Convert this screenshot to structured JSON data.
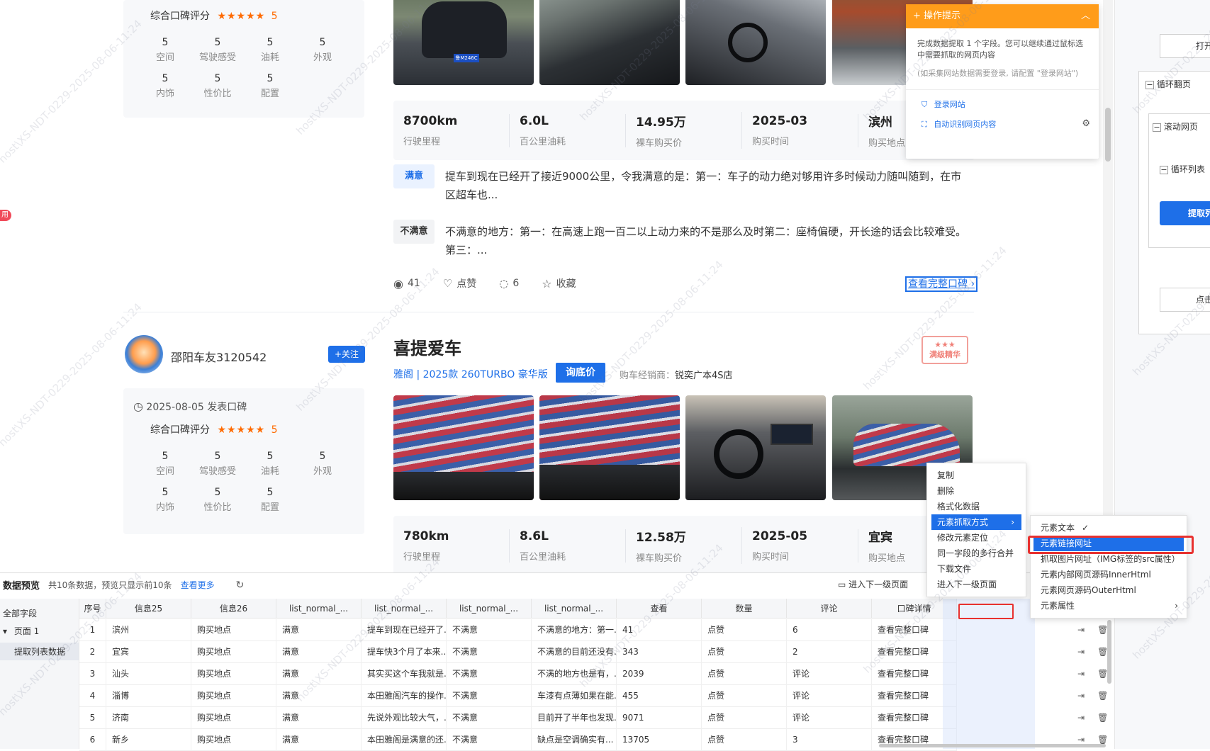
{
  "review1": {
    "rating_label": "综合口碑评分",
    "stars": "★★★★★",
    "rating": "5",
    "scores": [
      {
        "value": "5",
        "label": "空间"
      },
      {
        "value": "5",
        "label": "驾驶感受"
      },
      {
        "value": "5",
        "label": "油耗"
      },
      {
        "value": "5",
        "label": "外观"
      },
      {
        "value": "5",
        "label": "内饰"
      },
      {
        "value": "5",
        "label": "性价比"
      },
      {
        "value": "5",
        "label": "配置"
      }
    ],
    "stats": [
      {
        "value": "8700km",
        "label": "行驶里程"
      },
      {
        "value": "6.0L",
        "label": "百公里油耗"
      },
      {
        "value": "14.95万",
        "label": "裸车购买价"
      },
      {
        "value": "2025-03",
        "label": "购买时间"
      },
      {
        "value": "滨州",
        "label": "购买地点"
      }
    ],
    "satisfied_tag": "满意",
    "satisfied_text": "提车到现在已经开了接近9000公里，令我满意的是：第一：车子的动力绝对够用许多时候动力随叫随到，在市区超车也...",
    "unsatisfied_tag": "不满意",
    "unsatisfied_text": "不满意的地方：第一：在高速上跑一百二以上动力来的不是那么及时第二：座椅偏硬，开长途的话会比较难受。第三：...",
    "views": "41",
    "like_label": "点赞",
    "comments": "6",
    "collect_label": "收藏",
    "full_review_link": "查看完整口碑",
    "plate": "鲁M246C"
  },
  "review2": {
    "username": "邵阳车友3120542",
    "follow_label": "+关注",
    "date": "2025-08-05 发表口碑",
    "title": "喜提爱车",
    "model_link": "雅阁 | 2025款 260TURBO 豪华版",
    "inquiry_button": "询底价",
    "dealer_label": "购车经销商：",
    "dealer_name": "锐奕广本4S店",
    "badge": "满级精华",
    "badge_stars": "★★★",
    "rating_label": "综合口碑评分",
    "stars": "★★★★★",
    "rating": "5",
    "scores": [
      {
        "value": "5",
        "label": "空间"
      },
      {
        "value": "5",
        "label": "驾驶感受"
      },
      {
        "value": "5",
        "label": "油耗"
      },
      {
        "value": "5",
        "label": "外观"
      },
      {
        "value": "5",
        "label": "内饰"
      },
      {
        "value": "5",
        "label": "性价比"
      },
      {
        "value": "5",
        "label": "配置"
      }
    ],
    "stats": [
      {
        "value": "780km",
        "label": "行驶里程"
      },
      {
        "value": "8.6L",
        "label": "百公里油耗"
      },
      {
        "value": "12.58万",
        "label": "裸车购买价"
      },
      {
        "value": "2025-05",
        "label": "购买时间"
      },
      {
        "value": "宜宾",
        "label": "购买地点"
      }
    ]
  },
  "left_badge": "用",
  "tip_panel": {
    "title": "操作提示",
    "body": "完成数据提取 1 个字段。您可以继续通过鼠标选中需要抓取的网页内容",
    "note": "(如采集网站数据需要登录, 请配置 \"登录网站\")",
    "login_link": "登录网站",
    "auto_detect_link": "自动识别网页内容"
  },
  "right_panel": {
    "open_label": "打开",
    "loop_page": "循环翻页",
    "scroll_page": "滚动网页",
    "loop_list": "循环列表",
    "extract_button": "提取列",
    "click_label": "点击"
  },
  "context_menu": {
    "items": [
      "复制",
      "删除",
      "格式化数据",
      "元素抓取方式",
      "修改元素定位",
      "同一字段的多行合并",
      "下载文件",
      "进入下一级页面"
    ],
    "active_index": 3
  },
  "submenu": {
    "items": [
      "元素文本",
      "元素链接网址",
      "抓取图片网址（IMG标签的src属性）",
      "元素内部网页源码InnerHtml",
      "元素网页源码OuterHtml",
      "元素属性"
    ],
    "checked_index": 0,
    "active_index": 1,
    "check_mark": "✓"
  },
  "preview": {
    "title": "数据预览",
    "info": "共10条数据，预览只显示前10条",
    "more_link": "查看更多",
    "next_level": "进入下一级页面",
    "tree": {
      "all_fields": "全部字段",
      "page": "页面 1",
      "extract": "提取列表数据"
    },
    "columns": [
      "序号",
      "信息25",
      "信息26",
      "list_normal_...",
      "list_normal_...",
      "list_normal_...",
      "list_normal_...",
      "查看",
      "数量",
      "评论",
      "口碑详情"
    ],
    "rows": [
      [
        "1",
        "滨州",
        "购买地点",
        "满意",
        "提车到现在已经开了...",
        "不满意",
        "不满意的地方：第一...",
        "41",
        "点赞",
        "6",
        "查看完整口碑"
      ],
      [
        "2",
        "宜宾",
        "购买地点",
        "满意",
        "提车快3个月了本来...",
        "不满意",
        "不满意的目前还没有...",
        "343",
        "点赞",
        "2",
        "查看完整口碑"
      ],
      [
        "3",
        "汕头",
        "购买地点",
        "满意",
        "其实买这个车我就是...",
        "不满意",
        "不满的地方也是有，...",
        "2039",
        "点赞",
        "评论",
        "查看完整口碑"
      ],
      [
        "4",
        "淄博",
        "购买地点",
        "满意",
        "本田雅阁汽车的操作...",
        "不满意",
        "车漆有点薄如果在能...",
        "455",
        "点赞",
        "评论",
        "查看完整口碑"
      ],
      [
        "5",
        "济南",
        "购买地点",
        "满意",
        "先说外观比较大气，...",
        "不满意",
        "目前开了半年也发现...",
        "9071",
        "点赞",
        "评论",
        "查看完整口碑"
      ],
      [
        "6",
        "新乡",
        "购买地点",
        "满意",
        "本田雅阁是满意的还...",
        "不满意",
        "缺点是空调确实有...",
        "13705",
        "点赞",
        "3",
        "查看完整口碑"
      ]
    ]
  },
  "watermark_text": "host\\XS-NDT-0229-2025-08-06-11:24",
  "colors": {
    "accent": "#1e6fe8",
    "orange": "#ff9c1a",
    "red_highlight": "#e8312f",
    "star": "#ff6a00"
  }
}
